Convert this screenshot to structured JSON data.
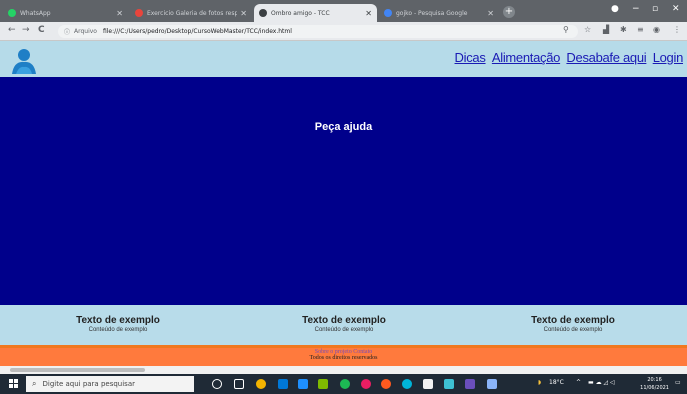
{
  "browser": {
    "tabs": [
      {
        "title": "WhatsApp",
        "color": "#25d366"
      },
      {
        "title": "Exercicio Galeria de fotos respo",
        "color": "#e8453c"
      },
      {
        "title": "Ombro amigo - TCC",
        "color": "#3c4043"
      },
      {
        "title": "gojko - Pesquisa Google",
        "color": "#4285f4"
      }
    ],
    "new_tab": "+",
    "window": {
      "minimize": "−",
      "maximize": "▫",
      "close": "✕"
    },
    "nav": {
      "back": "←",
      "forward": "→",
      "reload": "C"
    },
    "address": {
      "label": "Arquivo",
      "url": "file:///C:/Users/pedro/Desktop/CursoWebMaster/TCC/index.html"
    }
  },
  "site": {
    "nav": {
      "item1": "Dicas",
      "item2": "Alimentação",
      "item3": "Desabafe aqui",
      "item4": "Login"
    },
    "hero_text": "Peça ajuda",
    "cards": [
      {
        "title": "Texto de exemplo",
        "subtitle": "Conteúdo de exemplo"
      },
      {
        "title": "Texto de exemplo",
        "subtitle": "Conteúdo de exemplo"
      },
      {
        "title": "Texto de exemplo",
        "subtitle": "Conteúdo de exemplo"
      }
    ],
    "footer": {
      "links": "Sobre o projeto Contato",
      "copy": "Todos os direitos reservados"
    }
  },
  "taskbar": {
    "search_placeholder": "Digite aqui para pesquisar",
    "weather": "18°C",
    "time": "20:16",
    "date": "11/06/2021"
  },
  "colors": {
    "hero": "#00008b",
    "header": "#b6dbe9",
    "nav_link": "#1a1ab4",
    "footer": "#ff7a3d"
  }
}
